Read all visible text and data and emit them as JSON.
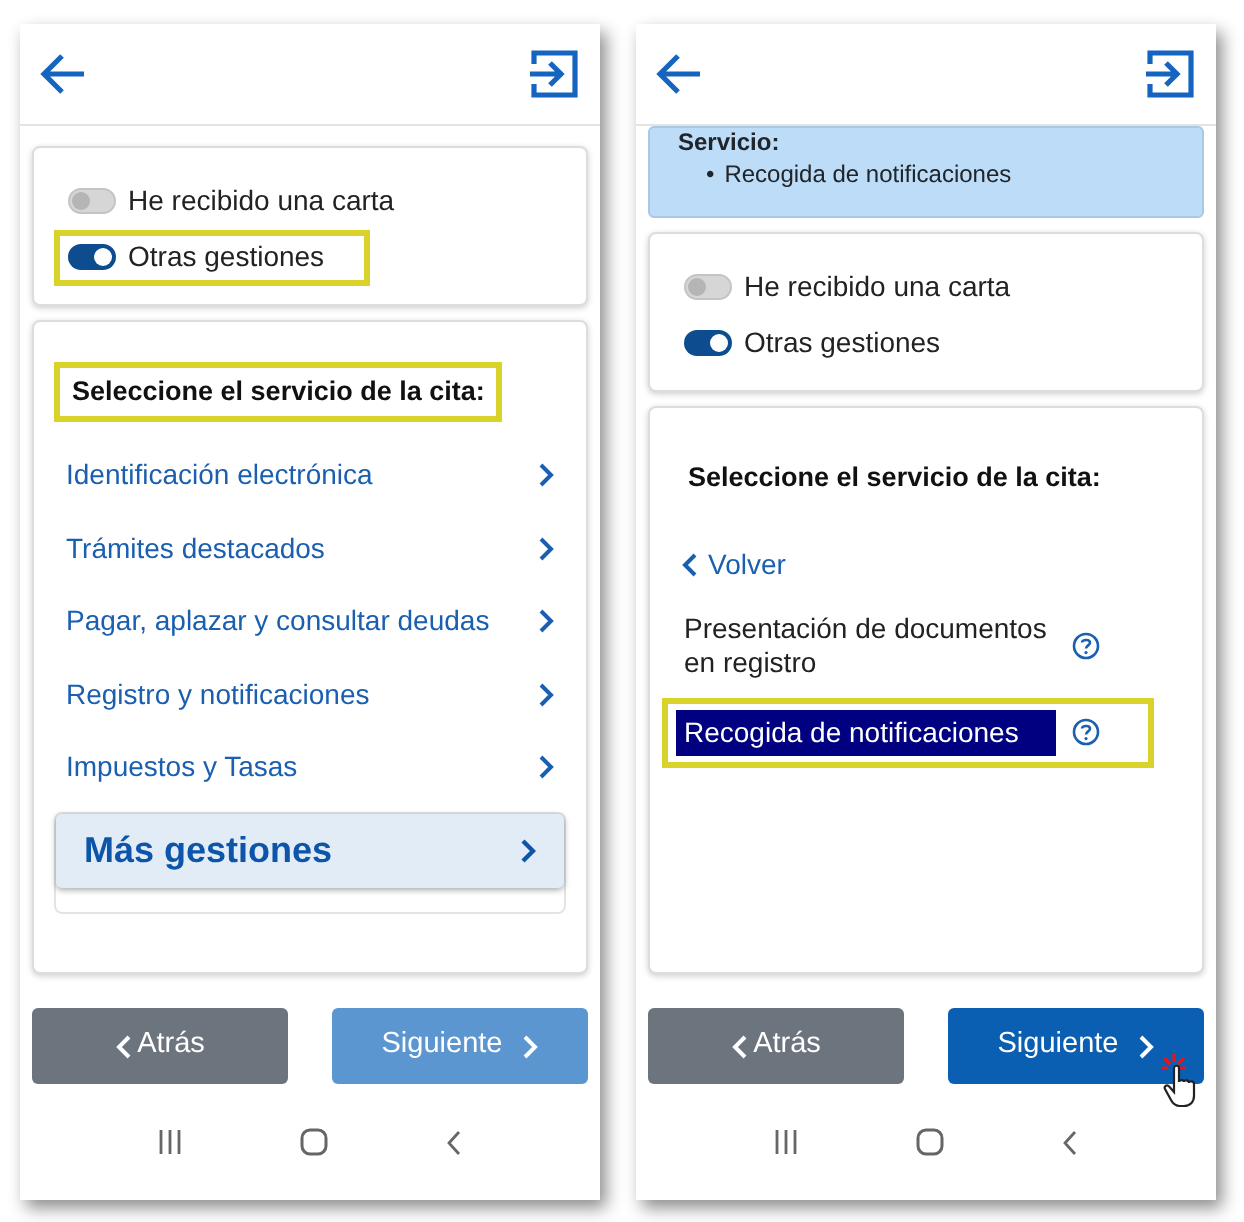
{
  "screens": [
    {
      "toggles": [
        {
          "label": "He recibido una carta",
          "on": false,
          "highlighted": false
        },
        {
          "label": "Otras gestiones",
          "on": true,
          "highlighted": true
        }
      ],
      "service": {
        "heading": "Seleccione el servicio de la cita:",
        "heading_highlighted": true,
        "options": [
          {
            "kind": "link",
            "label": "Identificación electrónica"
          },
          {
            "kind": "link",
            "label": "Trámites destacados"
          },
          {
            "kind": "link",
            "label": "Pagar, aplazar y consultar deudas"
          },
          {
            "kind": "link",
            "label": "Registro y notificaciones"
          },
          {
            "kind": "link",
            "label": "Impuestos y Tasas"
          },
          {
            "kind": "featured",
            "label": "Más gestiones"
          }
        ]
      },
      "buttons": [
        {
          "kind": "back",
          "label": "Atrás",
          "disabled": false,
          "cursor": false
        },
        {
          "kind": "next",
          "label": "Siguiente",
          "disabled": true,
          "cursor": false
        }
      ]
    },
    {
      "info": {
        "title": "Servicio:",
        "items": [
          {
            "bullet": "•",
            "text": "Recogida de notificaciones"
          }
        ]
      },
      "toggles": [
        {
          "label": "He recibido una carta",
          "on": false,
          "highlighted": false
        },
        {
          "label": "Otras gestiones",
          "on": true,
          "highlighted": false
        }
      ],
      "service": {
        "heading": "Seleccione el servicio de la cita:",
        "heading_highlighted": false,
        "back_link": "Volver",
        "options": [
          {
            "kind": "help",
            "label": "Presentación de documentos en registro",
            "selected": false,
            "highlighted": false
          },
          {
            "kind": "help",
            "label": "Recogida de notificaciones",
            "selected": true,
            "highlighted": true
          }
        ]
      },
      "buttons": [
        {
          "kind": "back",
          "label": "Atrás",
          "disabled": false,
          "cursor": false
        },
        {
          "kind": "next",
          "label": "Siguiente",
          "disabled": false,
          "cursor": true
        }
      ]
    }
  ]
}
